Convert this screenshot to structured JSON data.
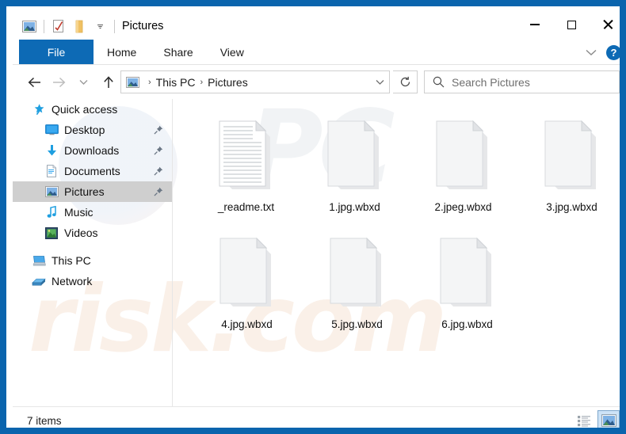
{
  "window": {
    "title": "Pictures",
    "quick_access_toolbar": [
      {
        "name": "pictures-folder-icon",
        "icon": "picture-folder-icon"
      },
      {
        "name": "properties-button",
        "icon": "properties-checkmark-icon"
      },
      {
        "name": "new-folder-button",
        "icon": "new-folder-icon"
      },
      {
        "name": "customize-qat-button",
        "icon": "chevron-down-icon"
      }
    ],
    "controls": {
      "minimize": "minimize-icon",
      "maximize": "maximize-icon",
      "close": "close-icon"
    }
  },
  "ribbon": {
    "tabs": [
      {
        "label": "File",
        "active": true
      },
      {
        "label": "Home",
        "active": false
      },
      {
        "label": "Share",
        "active": false
      },
      {
        "label": "View",
        "active": false
      }
    ],
    "collapse_icon": "chevron-down-icon",
    "help_label": "?"
  },
  "navigation": {
    "back_icon": "arrow-left-icon",
    "forward_icon": "arrow-right-icon",
    "recent_icon": "chevron-down-icon",
    "up_icon": "arrow-up-icon",
    "refresh_icon": "refresh-icon",
    "dropdown_icon": "chevron-down-icon"
  },
  "breadcrumb": {
    "icon": "pictures-icon",
    "separator": "›",
    "items": [
      {
        "label": "This PC"
      },
      {
        "label": "Pictures"
      }
    ]
  },
  "search": {
    "icon": "search-icon",
    "placeholder": "Search Pictures",
    "value": ""
  },
  "sidebar": {
    "items": [
      {
        "label": "Quick access",
        "icon": "star-pin-icon",
        "indent": false,
        "pinned": false,
        "selected": false
      },
      {
        "label": "Desktop",
        "icon": "desktop-icon",
        "indent": true,
        "pinned": true,
        "selected": false
      },
      {
        "label": "Downloads",
        "icon": "download-icon",
        "indent": true,
        "pinned": true,
        "selected": false
      },
      {
        "label": "Documents",
        "icon": "documents-icon",
        "indent": true,
        "pinned": true,
        "selected": false
      },
      {
        "label": "Pictures",
        "icon": "pictures-icon",
        "indent": true,
        "pinned": true,
        "selected": true
      },
      {
        "label": "Music",
        "icon": "music-note-icon",
        "indent": true,
        "pinned": false,
        "selected": false
      },
      {
        "label": "Videos",
        "icon": "videos-icon",
        "indent": true,
        "pinned": false,
        "selected": false
      },
      {
        "label": "This PC",
        "icon": "this-pc-icon",
        "indent": false,
        "pinned": false,
        "selected": false
      },
      {
        "label": "Network",
        "icon": "network-icon",
        "indent": false,
        "pinned": false,
        "selected": false
      }
    ]
  },
  "files": {
    "rows": [
      [
        {
          "name": "_readme.txt",
          "type": "text-file"
        },
        {
          "name": "1.jpg.wbxd",
          "type": "blank-file"
        },
        {
          "name": "2.jpeg.wbxd",
          "type": "blank-file"
        },
        {
          "name": "3.jpg.wbxd",
          "type": "blank-file"
        }
      ],
      [
        {
          "name": "4.jpg.wbxd",
          "type": "blank-file"
        },
        {
          "name": "5.jpg.wbxd",
          "type": "blank-file"
        },
        {
          "name": "6.jpg.wbxd",
          "type": "blank-file"
        }
      ]
    ]
  },
  "status": {
    "items_text": "7 items",
    "view_buttons": [
      {
        "name": "details-view-button",
        "icon": "details-view-icon",
        "active": false
      },
      {
        "name": "large-icons-view-button",
        "icon": "large-icons-view-icon",
        "active": true
      }
    ]
  },
  "watermark": {
    "top_text": "PC",
    "bottom_text": "risk.com"
  },
  "colors": {
    "window_border": "#0a64ad",
    "ribbon_accent": "#0d6ab5",
    "selection": "#cfcfcf",
    "view_active": "#cde3f7"
  }
}
